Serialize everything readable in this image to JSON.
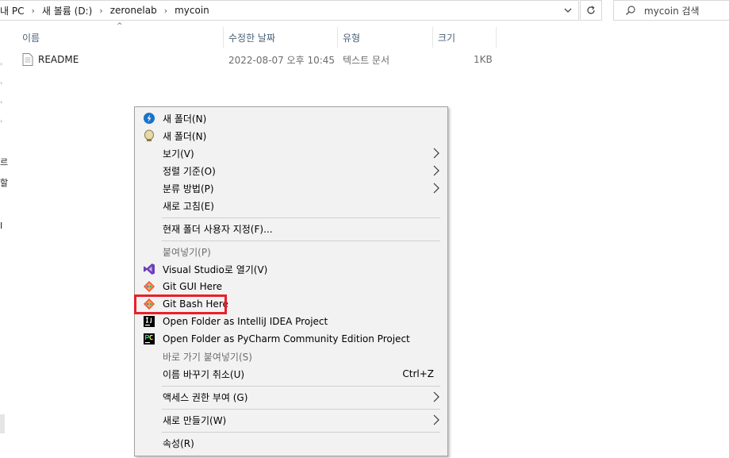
{
  "address": {
    "crumbs": [
      "내 PC",
      "새 볼륨 (D:)",
      "zeronelab",
      "mycoin"
    ]
  },
  "search": {
    "placeholder": "mycoin 검색"
  },
  "nav": {
    "fragments": [
      "르",
      "할",
      "I"
    ]
  },
  "columns": [
    "이름",
    "수정한 날짜",
    "유형",
    "크기"
  ],
  "files": [
    {
      "name": "README",
      "modified": "2022-08-07 오후 10:45",
      "type": "텍스트 문서",
      "size": "1KB"
    }
  ],
  "context_menu": {
    "items": [
      {
        "label": "새 폴더(N)",
        "icon": "new-folder-blue-icon"
      },
      {
        "label": "새 폴더(N)",
        "icon": "new-folder-alt-icon"
      },
      {
        "label": "보기(V)",
        "submenu": true
      },
      {
        "label": "정렬 기준(O)",
        "submenu": true
      },
      {
        "label": "분류 방법(P)",
        "submenu": true
      },
      {
        "label": "새로 고침(E)"
      },
      {
        "label": "현재 폴더 사용자 지정(F)..."
      },
      {
        "label": "붙여넣기(P)",
        "disabled": true
      },
      {
        "label": "Visual Studio로 열기(V)",
        "icon": "visual-studio-icon"
      },
      {
        "label": "Git GUI Here",
        "icon": "git-gui-icon"
      },
      {
        "label": "Git Bash Here",
        "icon": "git-bash-icon",
        "highlighted": true
      },
      {
        "label": "Open Folder as IntelliJ IDEA Project",
        "icon": "intellij-icon"
      },
      {
        "label": "Open Folder as PyCharm Community Edition Project",
        "icon": "pycharm-icon"
      },
      {
        "label": "바로 가기 붙여넣기(S)",
        "disabled": true
      },
      {
        "label": "이름 바꾸기 취소(U)",
        "shortcut": "Ctrl+Z"
      },
      {
        "label": "액세스 권한 부여 (G)",
        "submenu": true
      },
      {
        "label": "새로 만들기(W)",
        "submenu": true
      },
      {
        "label": "속성(R)"
      }
    ]
  },
  "colors": {
    "highlight_border": "#e8202a",
    "menu_bg": "#f2f2f2",
    "header_text": "#4c607a"
  }
}
